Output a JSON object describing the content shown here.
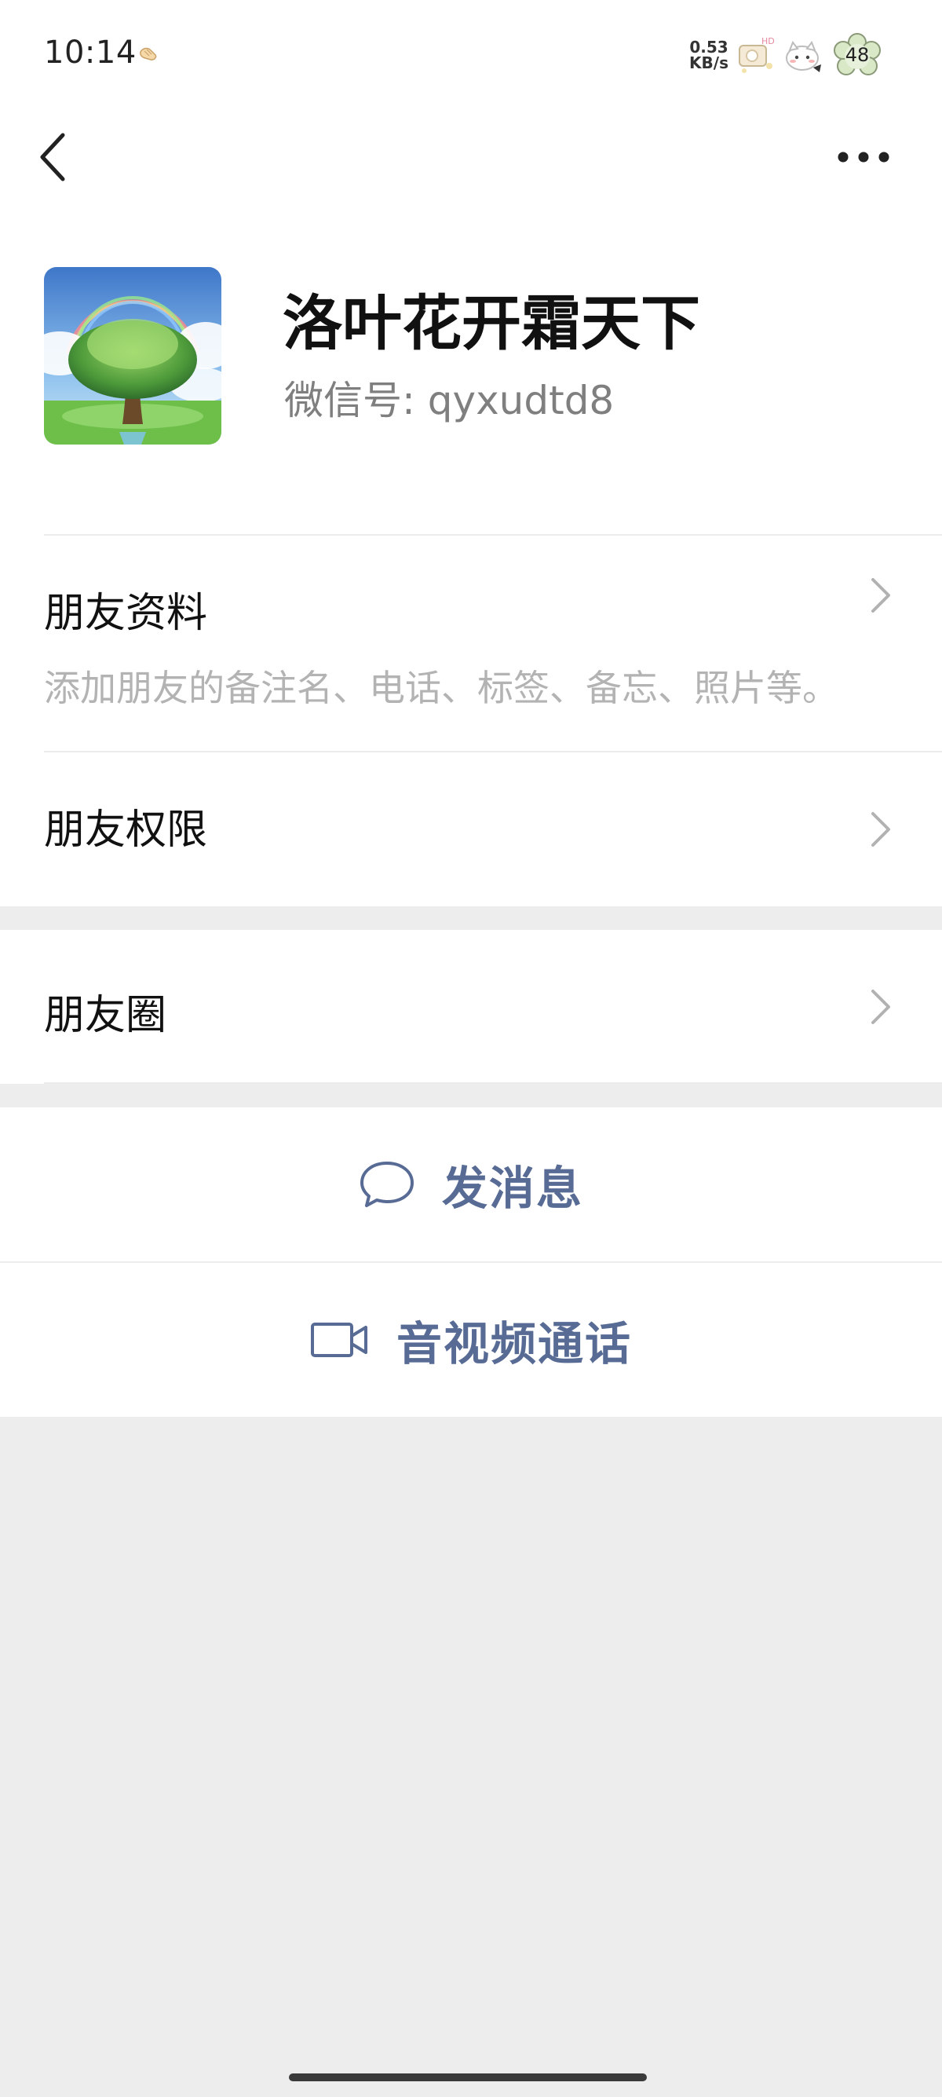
{
  "status_bar": {
    "time": "10:14",
    "net_speed_value": "0.53",
    "net_speed_unit": "KB/s",
    "battery_level": "48"
  },
  "profile": {
    "name": "洛叶花开霜天下",
    "wechat_id": "微信号:  qyxudtd8"
  },
  "menu": {
    "friend_info": {
      "title": "朋友资料",
      "subtitle": "添加朋友的备注名、电话、标签、备忘、照片等。"
    },
    "friend_permissions": {
      "title": "朋友权限"
    },
    "moments": {
      "title": "朋友圈"
    }
  },
  "actions": {
    "send_message": "发消息",
    "video_call": "音视频通话"
  },
  "colors": {
    "accent_link": "#576b95",
    "background": "#ededed",
    "surface": "#ffffff"
  },
  "icons": {
    "back": "chevron-left-icon",
    "more": "more-dots-icon",
    "message": "chat-bubble-icon",
    "video": "video-camera-icon"
  }
}
